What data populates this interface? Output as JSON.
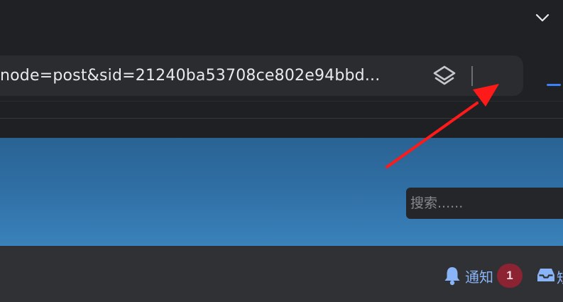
{
  "browser": {
    "url_text": "node=post&sid=21240ba53708ce802e94bbd...",
    "accent_color": "#3b82f6",
    "icons": {
      "window_menu": "chevron-down-icon",
      "site_info": "layers-icon"
    }
  },
  "page": {
    "search": {
      "placeholder": "搜索......",
      "value": ""
    },
    "nav": {
      "notifications_label": "通知",
      "notifications_count": "1",
      "inbox_label": "短",
      "badge_color": "#8b2332",
      "link_color": "#8ab4f8"
    }
  },
  "annotation": {
    "arrow_color": "#ff1a1a"
  }
}
